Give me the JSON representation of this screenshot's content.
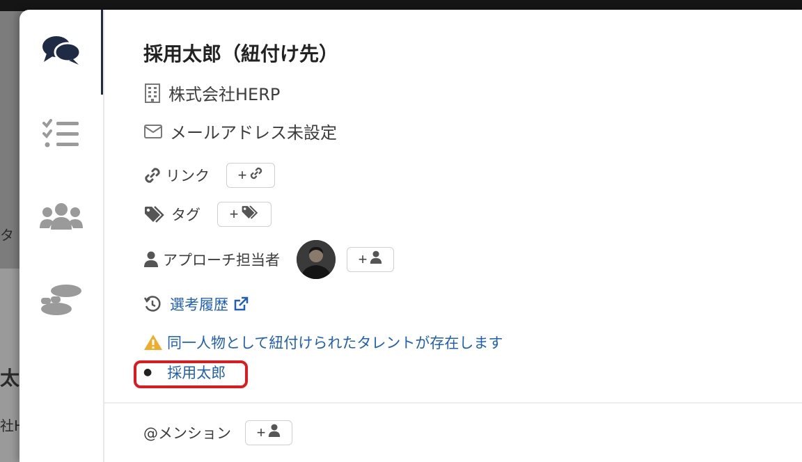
{
  "background": {
    "fragments": [
      "タ",
      "太良",
      "社H"
    ]
  },
  "rail": {
    "items": [
      {
        "icon": "comments-icon",
        "active": true
      },
      {
        "icon": "checklist-icon",
        "active": false
      },
      {
        "icon": "users-icon",
        "active": false
      },
      {
        "icon": "footprints-icon",
        "active": false
      }
    ]
  },
  "candidate": {
    "name": "採用太郎（紐付け先）",
    "company": "株式会社HERP",
    "email": "メールアドレス未設定"
  },
  "fields": {
    "link_label": "リンク",
    "tag_label": "タグ",
    "owner_label": "アプローチ担当者",
    "history_label": "選考履歴",
    "duplicate_warning": "同一人物として紐付けられたタレントが存在します",
    "duplicate_items": [
      "採用太郎"
    ],
    "mention_label": "@メンション"
  },
  "buttons": {
    "plus": "+"
  },
  "colors": {
    "link": "#1f5fb8",
    "warning": "#f0ad2c",
    "highlight": "#e0191f",
    "rail_icon_active": "#1f2a44",
    "rail_icon": "#9a9a9a"
  }
}
